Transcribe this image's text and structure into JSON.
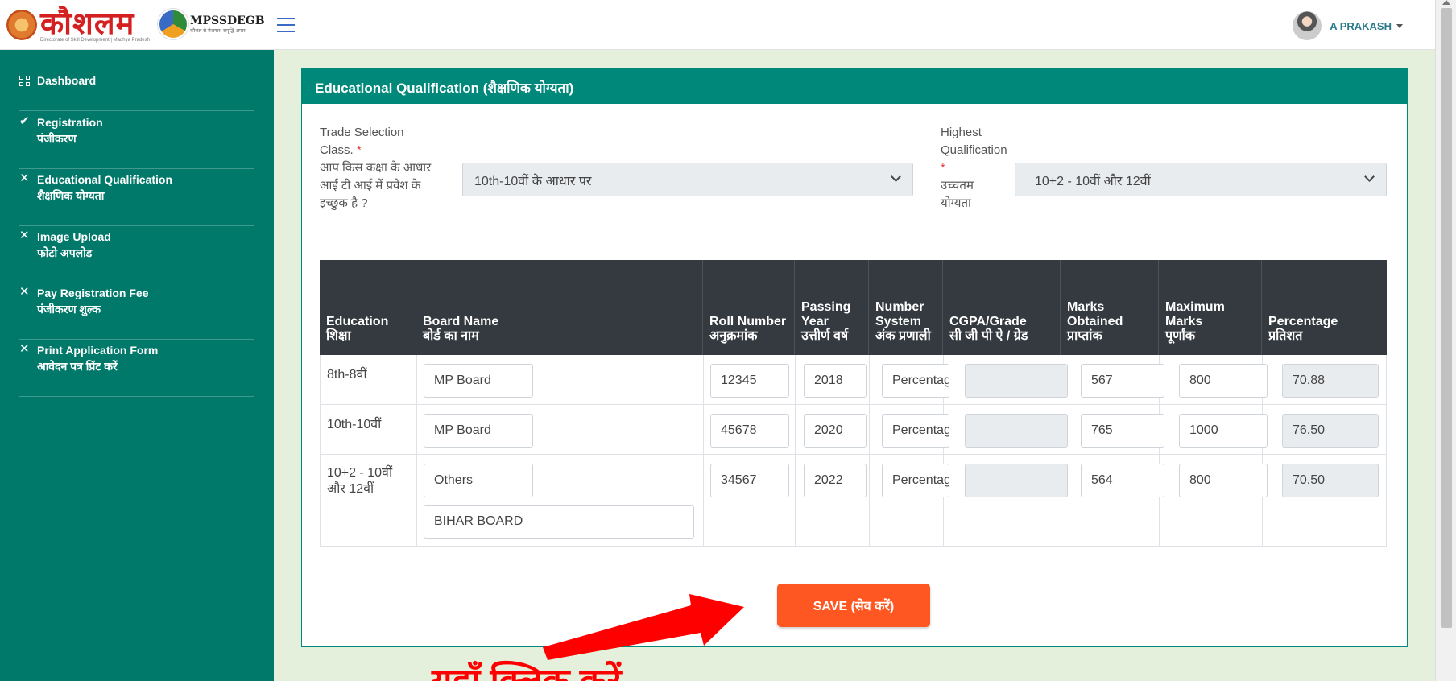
{
  "header": {
    "logo_text": "कौशलम",
    "logo_subtext": "Directorate of Skill Development | Madhya Pradesh",
    "logo2_text": "MPSSDEGB",
    "logo2_subtext": "कौशल से रोजगार, समृद्धि अपार",
    "user_name": "A PRAKASH"
  },
  "sidebar": {
    "items": [
      {
        "icon": "grid-icon",
        "label": "Dashboard",
        "label_hi": ""
      },
      {
        "icon": "check-icon",
        "label": "Registration",
        "label_hi": "पंजीकरण"
      },
      {
        "icon": "close-icon",
        "label": "Educational Qualification",
        "label_hi": "शैक्षणिक योग्यता"
      },
      {
        "icon": "close-icon",
        "label": "Image Upload",
        "label_hi": "फोटो अपलोड"
      },
      {
        "icon": "close-icon",
        "label": "Pay Registration Fee",
        "label_hi": "पंजीकरण शुल्क"
      },
      {
        "icon": "close-icon",
        "label": "Print Application Form",
        "label_hi": "आवेदन पत्र प्रिंट करें"
      }
    ]
  },
  "card": {
    "title": "Educational Qualification (शैक्षणिक योग्यता)"
  },
  "form": {
    "trade_label_1": "Trade Selection",
    "trade_label_2": "Class.",
    "trade_label_hi_1": "आप किस कक्षा के आधार",
    "trade_label_hi_2": "आई टी आई में प्रवेश के",
    "trade_label_hi_3": "इच्छुक है ?",
    "trade_value": "10th-10वीं के आधार पर",
    "highest_label_1": "Highest",
    "highest_label_2": "Qualification",
    "highest_label_hi_1": "उच्चतम",
    "highest_label_hi_2": "योग्यता",
    "highest_value": "10+2 - 10वीं और 12वीं",
    "required_mark": "*"
  },
  "table": {
    "headers": [
      {
        "en": "Education",
        "hi": "शिक्षा"
      },
      {
        "en": "Board Name",
        "hi": "बोर्ड का नाम"
      },
      {
        "en": "Roll Number",
        "hi": "अनुक्रमांक"
      },
      {
        "en": "Passing Year",
        "hi": "उत्तीर्ण वर्ष"
      },
      {
        "en": "Number System",
        "hi": "अंक प्रणाली"
      },
      {
        "en": "CGPA/Grade",
        "hi": "सी जी पी ऐ / ग्रेड"
      },
      {
        "en": "Marks Obtained",
        "hi": "प्राप्तांक"
      },
      {
        "en": "Maximum Marks",
        "hi": "पूर्णांक"
      },
      {
        "en": "Percentage",
        "hi": "प्रतिशत"
      }
    ],
    "rows": [
      {
        "education": "8th-8वीं",
        "education_2": "",
        "board": "MP Board",
        "board_other": "",
        "roll": "12345",
        "year": "2018",
        "system": "Percentage",
        "cgpa": "",
        "marks": "567",
        "max": "800",
        "pct": "70.88"
      },
      {
        "education": "10th-10वीं",
        "education_2": "",
        "board": "MP Board",
        "board_other": "",
        "roll": "45678",
        "year": "2020",
        "system": "Percentage",
        "cgpa": "",
        "marks": "765",
        "max": "1000",
        "pct": "76.50"
      },
      {
        "education": "10+2 - 10वीं",
        "education_2": "और 12वीं",
        "board": "Others",
        "board_other": "BIHAR BOARD",
        "roll": "34567",
        "year": "2022",
        "system": "Percentage",
        "cgpa": "",
        "marks": "564",
        "max": "800",
        "pct": "70.50"
      }
    ]
  },
  "save_label": "SAVE (सेव करें)",
  "annotation": "यहाँ क्लिक करें",
  "colors": {
    "accent": "#00897b",
    "sidebar": "#00796b",
    "save": "#ff5722",
    "arrow": "#ff0000"
  }
}
